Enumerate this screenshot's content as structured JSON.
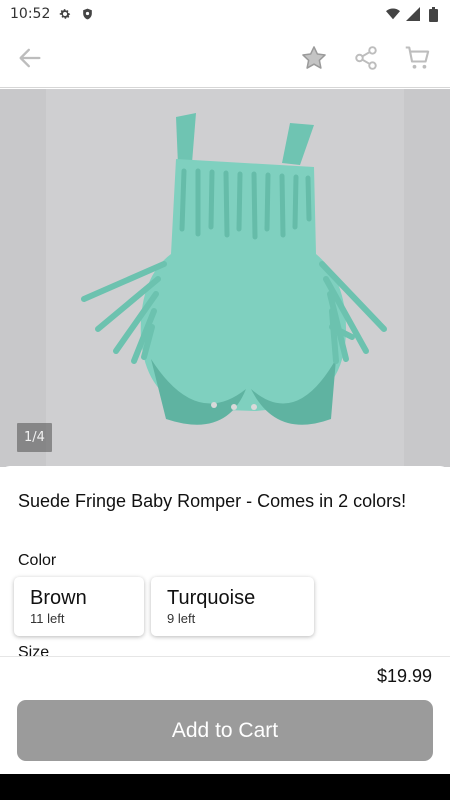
{
  "status_bar": {
    "time": "10:52",
    "icons": [
      "settings-icon",
      "shield-icon",
      "wifi-icon",
      "signal-icon",
      "battery-icon"
    ]
  },
  "app_bar": {
    "back_icon": "arrow-left-icon",
    "actions": [
      "star-icon",
      "share-icon",
      "cart-icon"
    ]
  },
  "gallery": {
    "counter": "1/4",
    "product_color": "#7fd0bf"
  },
  "product": {
    "title": "Suede Fringe Baby Romper - Comes in 2 colors!",
    "color_label": "Color",
    "colors": [
      {
        "name": "Brown",
        "stock": "11 left"
      },
      {
        "name": "Turquoise",
        "stock": "9 left"
      }
    ],
    "size_label": "Size"
  },
  "footer": {
    "price": "$19.99",
    "add_to_cart": "Add to Cart",
    "button_color": "#9b9b9b"
  }
}
